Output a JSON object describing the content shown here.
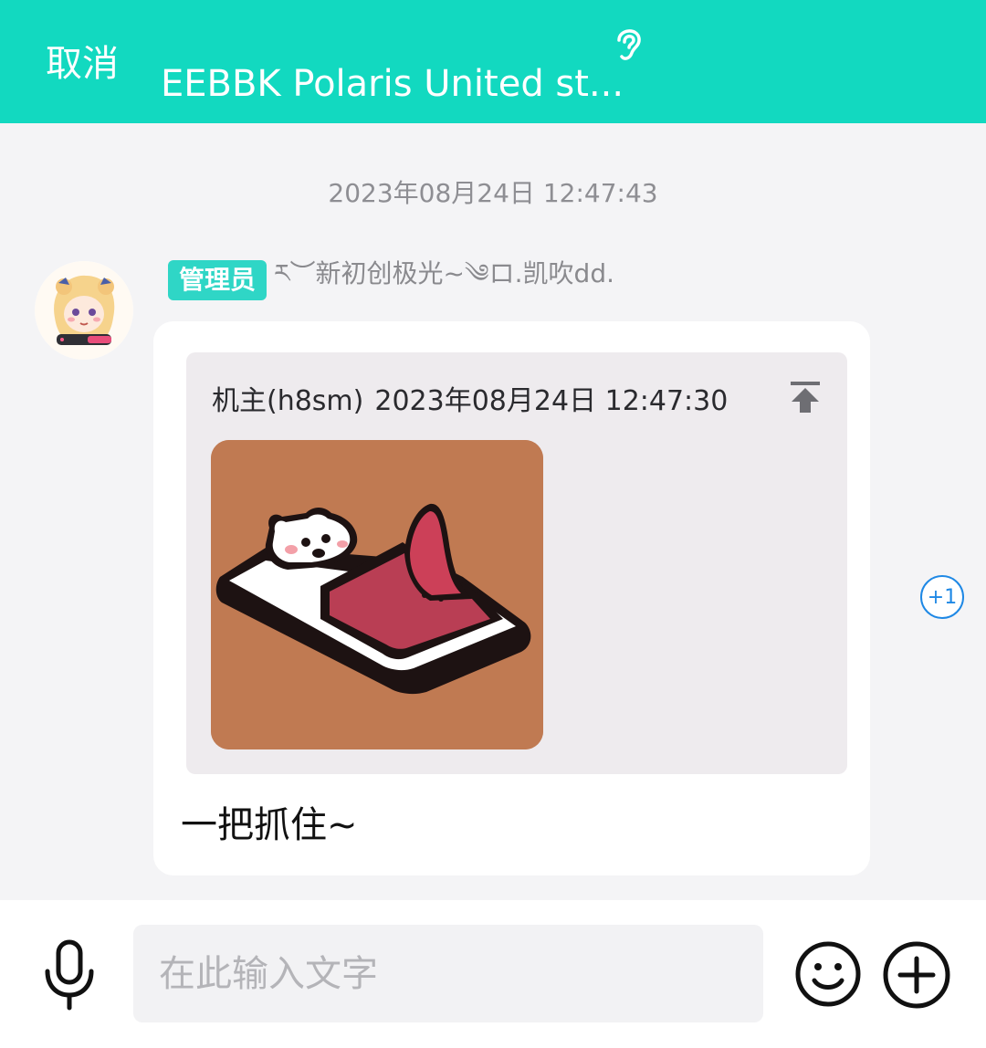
{
  "header": {
    "cancel_label": "取消",
    "title": "EEBBK Polaris United st...",
    "background_color": "#12d9c0",
    "listen_icon": "ear-icon"
  },
  "chat": {
    "timestamp": "2023年08月24日 12:47:43",
    "message": {
      "avatar": "anime-girl-avatar",
      "admin_badge": "管理员",
      "sender_name": "ར︶新初创极光~༄ロ.凯吹dd.",
      "quote": {
        "author": "机主(h8sm)",
        "time": "2023年08月24日 12:47:30",
        "top_icon": "pin-to-top-icon",
        "image": "cat-in-bed-sticker"
      },
      "text": "一把抓住~",
      "reaction_label": "+1"
    }
  },
  "footer": {
    "input_placeholder": "在此输入文字",
    "mic_icon": "microphone-icon",
    "emoji_icon": "smile-icon",
    "more_icon": "plus-circle-icon"
  }
}
